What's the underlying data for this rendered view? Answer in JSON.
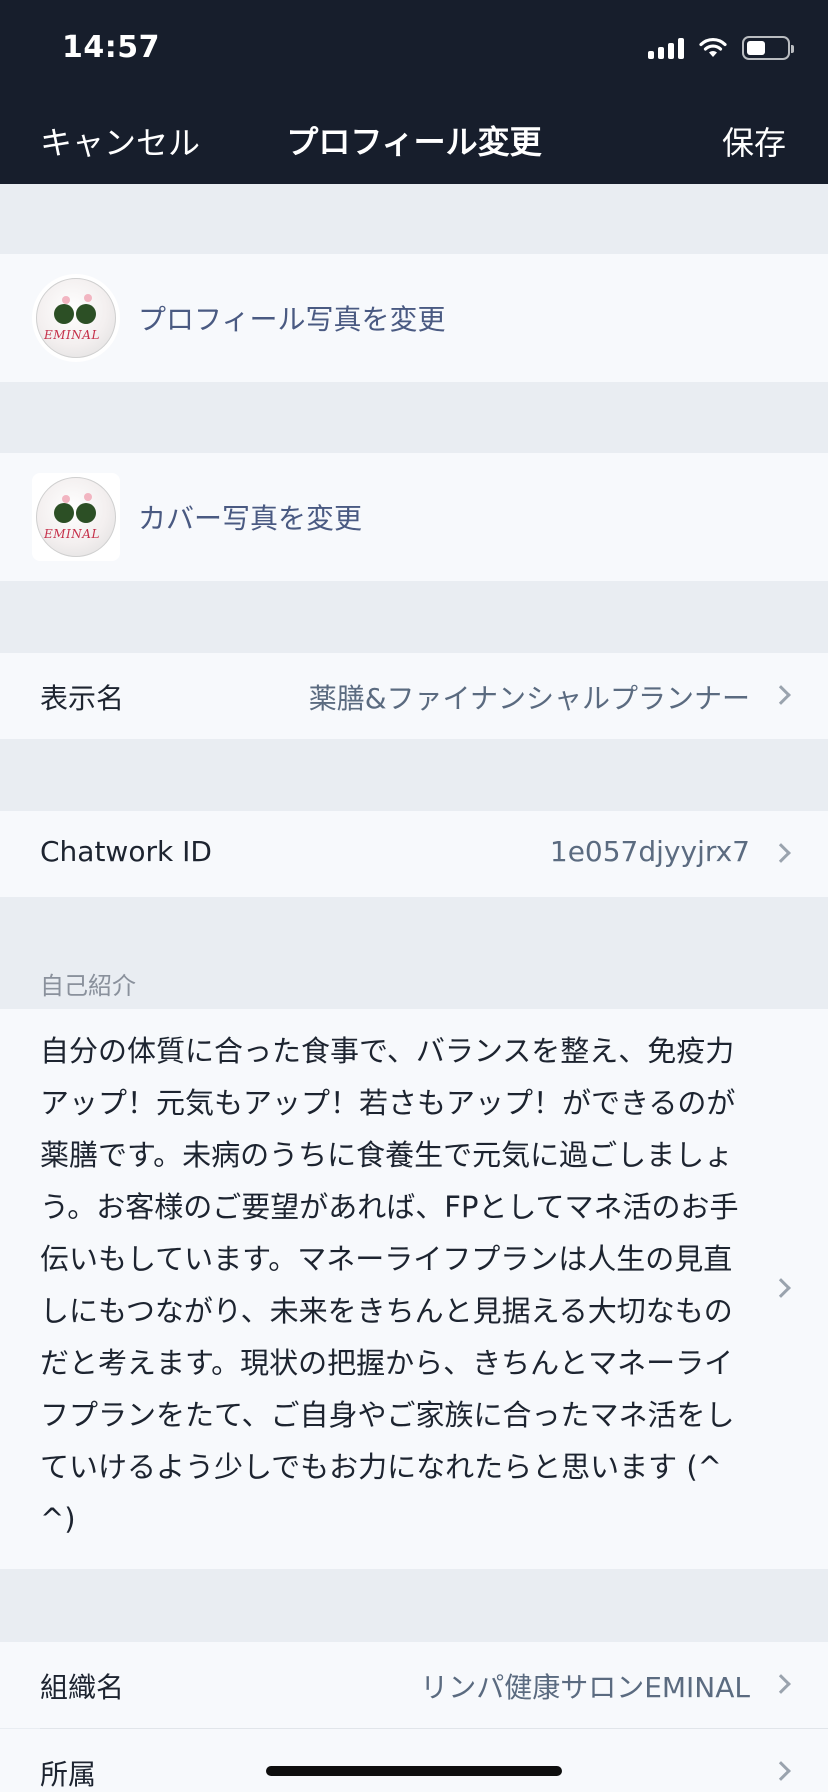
{
  "status_bar": {
    "time": "14:57",
    "icons": [
      "signal-icon",
      "wifi-icon",
      "battery-icon"
    ]
  },
  "nav": {
    "cancel_label": "キャンセル",
    "title": "プロフィール変更",
    "save_label": "保存"
  },
  "profile_photo": {
    "label": "プロフィール写真を変更",
    "logo_text": "EMINAL"
  },
  "cover_photo": {
    "label": "カバー写真を変更",
    "logo_text": "EMINAL"
  },
  "display_name": {
    "label": "表示名",
    "value": "薬膳&ファイナンシャルプランナー"
  },
  "chatwork_id": {
    "label": "Chatwork ID",
    "value": "1e057djyyjrx7"
  },
  "bio": {
    "caption": "自己紹介",
    "text": "自分の体質に合った食事で、バランスを整え、免疫力アップ！元気もアップ！若さもアップ！ができるのが薬膳です。未病のうちに食養生で元気に過ごしましょう。お客様のご要望があれば、FPとしてマネ活のお手伝いもしています。マネーライフプランは人生の見直しにもつながり、未来をきちんと見据える大切なものだと考えます。現状の把握から、きちんとマネーライフプランをたて、ご自身やご家族に合ったマネ活をしていけるよう少しでもお力になれたらと思います (^^)"
  },
  "organization": {
    "label": "組織名",
    "value": "リンパ健康サロンEMINAL"
  },
  "affiliation": {
    "label": "所属"
  },
  "colors": {
    "header_bg": "#171e2c",
    "page_bg": "#e9edf2",
    "row_bg": "#f7f9fc",
    "link_text": "#4a5a82",
    "value_text": "#5b6b80"
  }
}
